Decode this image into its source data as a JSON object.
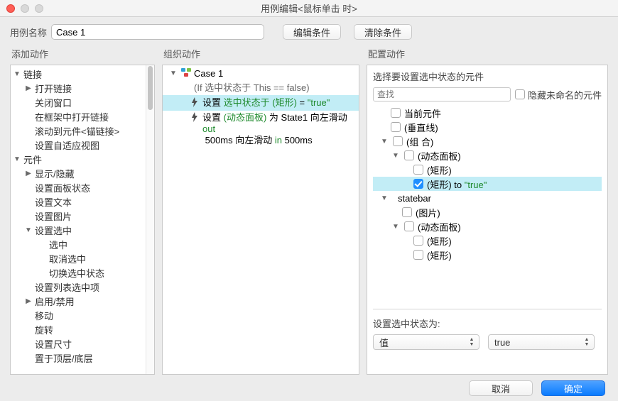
{
  "window": {
    "title": "用例编辑<鼠标单击 时>"
  },
  "nameRow": {
    "label": "用例名称",
    "value": "Case 1",
    "editCondBtn": "编辑条件",
    "clearCondBtn": "清除条件"
  },
  "addActions": {
    "heading": "添加动作",
    "groups": [
      {
        "label": "链接",
        "expanded": true,
        "items": [
          {
            "label": "打开链接",
            "expandable": true
          },
          {
            "label": "关闭窗口"
          },
          {
            "label": "在框架中打开链接"
          },
          {
            "label": "滚动到元件<锚链接>"
          },
          {
            "label": "设置自适应视图"
          }
        ]
      },
      {
        "label": "元件",
        "expanded": true,
        "items": [
          {
            "label": "显示/隐藏",
            "expandable": true
          },
          {
            "label": "设置面板状态"
          },
          {
            "label": "设置文本"
          },
          {
            "label": "设置图片"
          },
          {
            "label": "设置选中",
            "expandable": true,
            "expanded": true,
            "children": [
              {
                "label": "选中"
              },
              {
                "label": "取消选中"
              },
              {
                "label": "切换选中状态"
              }
            ]
          },
          {
            "label": "设置列表选中项"
          },
          {
            "label": "启用/禁用",
            "expandable": true
          },
          {
            "label": "移动"
          },
          {
            "label": "旋转"
          },
          {
            "label": "设置尺寸"
          },
          {
            "label": "置于顶层/底层"
          }
        ]
      }
    ]
  },
  "orgActions": {
    "heading": "组织动作",
    "caseName": "Case 1",
    "condition": "(If 选中状态于 This == false)",
    "row1": {
      "prefix": "设置 ",
      "mid": "选中状态于 (矩形)",
      "eq": " = ",
      "val": "\"true\""
    },
    "row2": {
      "prefix": "设置 ",
      "mid1": "(动态面板)",
      "plain1": " 为 State1 向左滑动 ",
      "mid2": "out",
      "plain2": " 500ms 向左滑动 ",
      "mid3": "in",
      "plain3": " 500ms"
    }
  },
  "cfgActions": {
    "heading": "配置动作",
    "prompt": "选择要设置选中状态的元件",
    "searchPlaceholder": "查找",
    "hideUnnamed": "隐藏未命名的元件",
    "tree": {
      "currentWidget": "当前元件",
      "vline": "(垂直线)",
      "group": "(组 合)",
      "dynPanel": "(动态面板)",
      "rect": "(矩形)",
      "rectToTruePrefix": "(矩形) to ",
      "rectToTrueVal": "\"true\"",
      "statebar": "statebar",
      "image": "(图片)",
      "dynPanel2": "(动态面板)",
      "rect2": "(矩形)",
      "rect3": "(矩形)"
    },
    "setLabel": "设置选中状态为:",
    "valTypeSel": "值",
    "valSel": "true"
  },
  "footer": {
    "cancel": "取消",
    "ok": "确定"
  }
}
